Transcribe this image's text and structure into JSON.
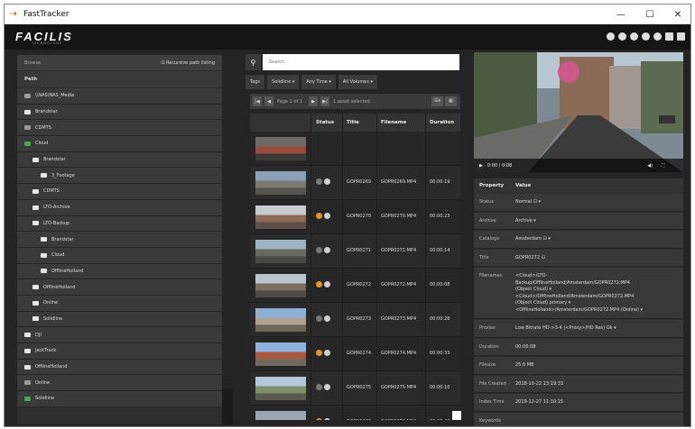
{
  "window": {
    "title": "FastTracker",
    "minimize": "—",
    "maximize": "☐",
    "close": "✕"
  },
  "logo": {
    "text": "FACILIS",
    "sub": "TECHNOLOGY"
  },
  "left": {
    "browse_label": "Browse",
    "recursive_label": "⊡ Recursive path listing",
    "path_header": "Path",
    "tree": [
      {
        "label": "\\\\NAS\\NAS_Media",
        "indent": 0,
        "icon": "dim"
      },
      {
        "label": "Brandstar",
        "indent": 0,
        "icon": "white"
      },
      {
        "label": "CDMTS",
        "indent": 0,
        "icon": "dim"
      },
      {
        "label": "Cloud",
        "indent": 0,
        "icon": "green"
      },
      {
        "label": "Brandstar",
        "indent": 1,
        "icon": "white"
      },
      {
        "label": "3_Footage",
        "indent": 2,
        "icon": "white"
      },
      {
        "label": "CDMTS",
        "indent": 1,
        "icon": "white"
      },
      {
        "label": "LTO-Archive",
        "indent": 1,
        "icon": "white"
      },
      {
        "label": "LTO-Backup",
        "indent": 1,
        "icon": "white"
      },
      {
        "label": "Brandstar",
        "indent": 2,
        "icon": "white"
      },
      {
        "label": "Cloud",
        "indent": 2,
        "icon": "white"
      },
      {
        "label": "OfflineHolland",
        "indent": 2,
        "icon": "white"
      },
      {
        "label": "OfflineHolland",
        "indent": 1,
        "icon": "white"
      },
      {
        "label": "Online",
        "indent": 1,
        "icon": "white"
      },
      {
        "label": "Solidline",
        "indent": 1,
        "icon": "white"
      },
      {
        "label": "DJI",
        "indent": 0,
        "icon": "white"
      },
      {
        "label": "JackTrack",
        "indent": 0,
        "icon": "white"
      },
      {
        "label": "OfflineHolland",
        "indent": 0,
        "icon": "white"
      },
      {
        "label": "Online",
        "indent": 0,
        "icon": "dim"
      },
      {
        "label": "Solidline",
        "indent": 0,
        "icon": "green"
      }
    ]
  },
  "center": {
    "search_placeholder": "Search",
    "search_icon": "search-icon",
    "filters": [
      "Tags",
      "Solidline ▾",
      "Any Time ▾",
      "All Volumes ▾"
    ],
    "pager": {
      "page_text": "Page 1 of 1",
      "selected_text": "1 asset selected"
    },
    "columns": {
      "status": "Status",
      "title": "Title",
      "filename": "Filename",
      "duration": "Duration"
    },
    "rows": [
      {
        "title": "",
        "filename": "",
        "duration": "",
        "status": "",
        "thumb": [
          "#6d6a66",
          "#9a4c3d",
          "#3d3a38"
        ]
      },
      {
        "title": "GOPR0269",
        "filename": "GOPR0269.MP4",
        "duration": "00:00:19",
        "status": "grey",
        "thumb": [
          "#8aa1b8",
          "#7a7a72",
          "#55544f"
        ]
      },
      {
        "title": "GOPR0270",
        "filename": "GOPR0270.MP4",
        "duration": "00:00:23",
        "status": "orange",
        "thumb": [
          "#c7ccd0",
          "#8c6a55",
          "#5a5048"
        ]
      },
      {
        "title": "GOPR0271",
        "filename": "GOPR0271.MP4",
        "duration": "00:00:14",
        "status": "grey",
        "thumb": [
          "#9fb2c4",
          "#6a6a60",
          "#4a4a45"
        ]
      },
      {
        "title": "GOPR0272",
        "filename": "GOPR0272.MP4",
        "duration": "00:00:08",
        "status": "orange",
        "thumb": [
          "#b9c4cc",
          "#7a6e60",
          "#4f4a45"
        ]
      },
      {
        "title": "GOPR0273",
        "filename": "GOPR0273.MP4",
        "duration": "00:00:28",
        "status": "grey",
        "thumb": [
          "#8fb0d6",
          "#b0a090",
          "#6f665a"
        ]
      },
      {
        "title": "GOPR0274",
        "filename": "GOPR0274.MP4",
        "duration": "00:00:33",
        "status": "orange",
        "thumb": [
          "#8fb2da",
          "#a8583f",
          "#6e6a5f"
        ]
      },
      {
        "title": "GOPR0275",
        "filename": "GOPR0275.MP4",
        "duration": "00:00:10",
        "status": "grey",
        "thumb": [
          "#b5c7d8",
          "#7e8f6a",
          "#5c5a50"
        ]
      },
      {
        "title": "GOPR0276",
        "filename": "GOPR0276.MP4",
        "duration": "00:00:48",
        "status": "orange",
        "thumb": [
          "#9aa7b3",
          "#7a6a5a",
          "#55504a"
        ]
      }
    ]
  },
  "preview": {
    "time": "0:00 / 0:08",
    "play": "▶",
    "volume": "◀)",
    "fullscreen": "⛶"
  },
  "props": {
    "header_property": "Property",
    "header_value": "Value",
    "rows": [
      {
        "key": "Status",
        "lines": [
          "Normal ⊡ ▾"
        ]
      },
      {
        "key": "Archive",
        "lines": [
          "Archive ▾"
        ]
      },
      {
        "key": "Catalogs",
        "lines": [
          "Amsterdam ⊡ ▾"
        ]
      },
      {
        "key": "Title",
        "lines": [
          "GOPR0272 ⊡"
        ]
      },
      {
        "key": "Filenames",
        "lines": [
          "<Cloud>/LTO-",
          "Backup/OfflineHolland/Amsterdam/GOPR0272.MP4",
          "(Object Cloud) ▾",
          "<Cloud>/OfflineHolland/Amsterdam/GOPR0272.MP4",
          "(Object Cloud) primary ▾",
          "<OfflineHolland>/Amsterdam/GOPR0272.MP4 (Online) ▾"
        ]
      },
      {
        "key": "Proxies",
        "lines": [
          "Low Bitrate HD->3-4 (<Proxy>/HD Res) Ok ▾"
        ]
      },
      {
        "key": "Duration",
        "lines": [
          "00:00:08"
        ]
      },
      {
        "key": "Filesize",
        "lines": [
          "25.6 MB"
        ]
      },
      {
        "key": "File Created",
        "lines": [
          "2018-10-22 13:19:33"
        ]
      },
      {
        "key": "Index Time",
        "lines": [
          "2019-12-27 11:10:15"
        ]
      },
      {
        "key": "Keywords",
        "lines": [
          ""
        ]
      }
    ]
  }
}
